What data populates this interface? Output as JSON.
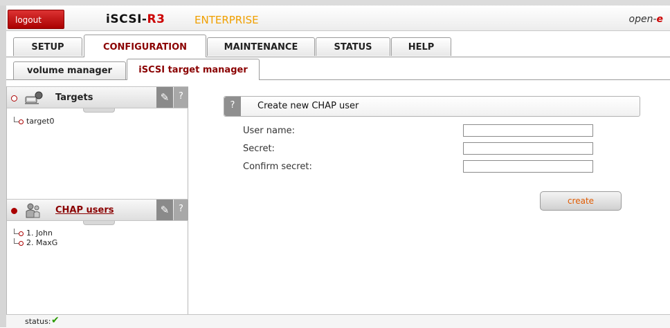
{
  "header": {
    "logout_label": "logout",
    "brand_main": "iSCSI-",
    "brand_r3": "R3",
    "edition": "ENTERPRISE",
    "vendor_prefix": "open-",
    "vendor_e": "e"
  },
  "tabs": [
    {
      "label": "SETUP",
      "active": false
    },
    {
      "label": "CONFIGURATION",
      "active": true
    },
    {
      "label": "MAINTENANCE",
      "active": false
    },
    {
      "label": "STATUS",
      "active": false
    },
    {
      "label": "HELP",
      "active": false
    }
  ],
  "subtabs": [
    {
      "label": "volume manager",
      "active": false
    },
    {
      "label": "iSCSI target manager",
      "active": true
    }
  ],
  "targets_panel": {
    "title": "Targets",
    "help": "?",
    "items": [
      "target0"
    ]
  },
  "chap_panel": {
    "title": "CHAP users",
    "help": "?",
    "items": [
      "1. John",
      "2. MaxG"
    ]
  },
  "form": {
    "help": "?",
    "title": "Create new CHAP user",
    "username_label": "User name:",
    "username_value": "",
    "secret_label": "Secret:",
    "secret_value": "",
    "confirm_label": "Confirm secret:",
    "confirm_value": "",
    "create_label": "create"
  },
  "status": {
    "label": "status:",
    "icon": "checkmark-icon",
    "icon_glyph": "✔",
    "color": "#2a9a00"
  },
  "colors": {
    "accent": "#8a0000",
    "logout": "#c00000",
    "edition": "#f0a000",
    "create_text": "#e05a00"
  }
}
